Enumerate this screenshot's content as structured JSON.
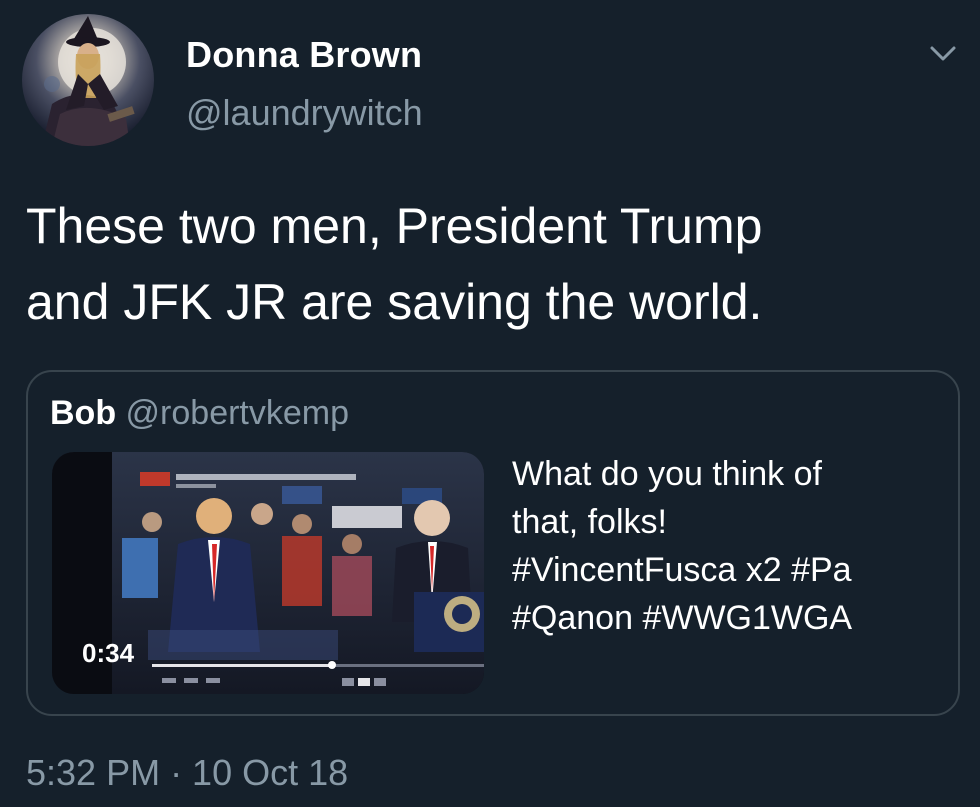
{
  "tweet": {
    "display_name": "Donna Brown",
    "handle": "@laundrywitch",
    "text_lines": [
      "These two men, President Trump",
      "and JFK JR are saving the world."
    ],
    "timestamp": "5:32 PM · 10 Oct 18",
    "menu_icon": "chevron-down-icon",
    "avatar_icon": "witch-avatar"
  },
  "quoted_tweet": {
    "name": "Bob",
    "handle": "@robertvkemp",
    "text_lines": [
      "What do you think of",
      "that, folks!",
      "#VincentFusca x2 #Pa",
      "#Qanon #WWG1WGA"
    ],
    "video": {
      "duration": "0:34",
      "play_icon": "play-icon",
      "thumbnail": "rally-video-thumbnail"
    }
  },
  "colors": {
    "background": "#15202b",
    "primary_text": "#ffffff",
    "secondary_text": "#8899a6",
    "border": "#38444d"
  }
}
